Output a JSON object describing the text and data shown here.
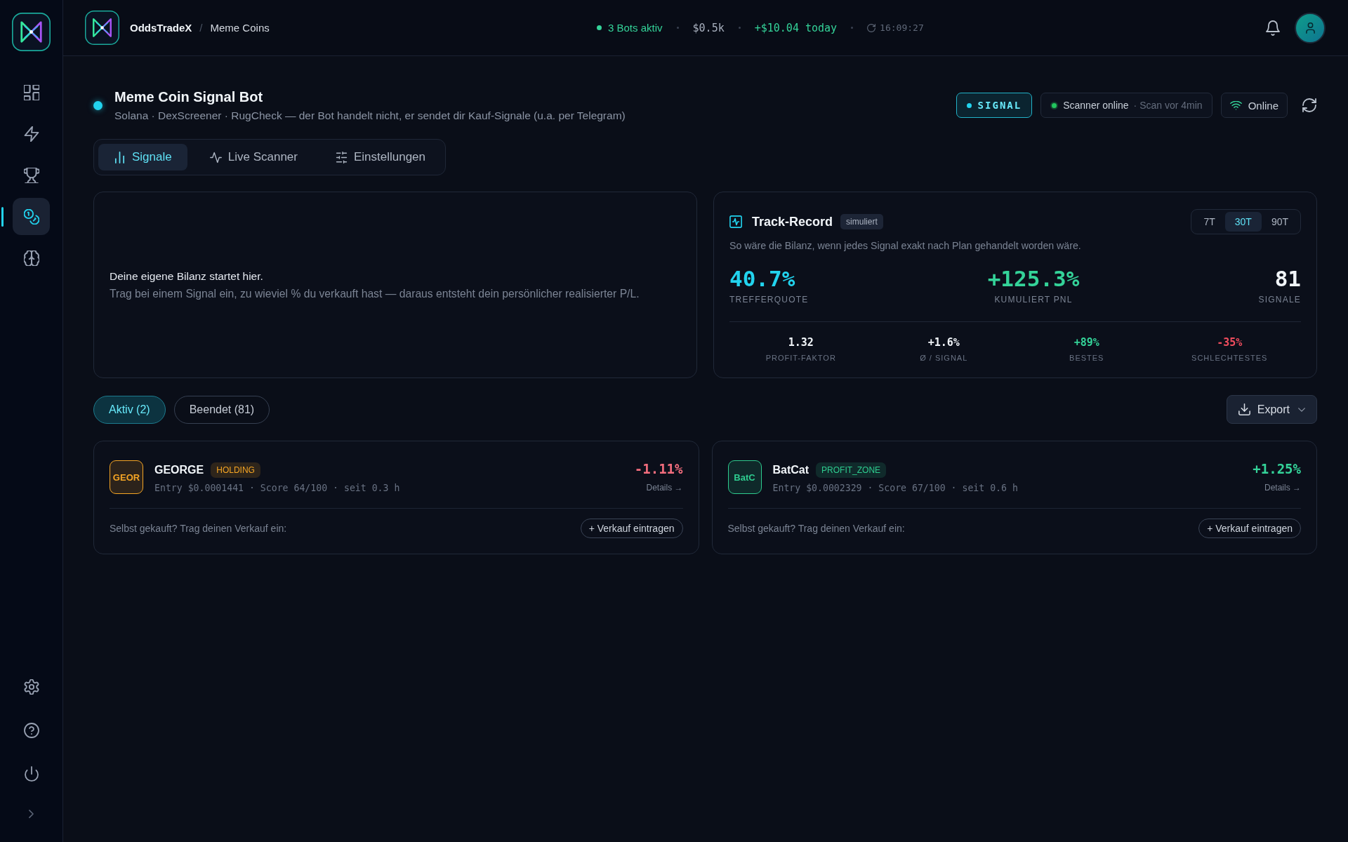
{
  "sidebar": {
    "items": [
      {
        "kind": "dashboard",
        "selected": false
      },
      {
        "kind": "bolt",
        "selected": false
      },
      {
        "kind": "trophy",
        "selected": false
      },
      {
        "kind": "coins",
        "selected": true
      },
      {
        "kind": "brain",
        "selected": false
      }
    ]
  },
  "header": {
    "brand": "OddsTradeX",
    "separator": "/",
    "page": "Meme Coins",
    "bots": "3 Bots aktiv",
    "balance": "$0.5k",
    "today": "+$10.04 today",
    "updated": "16:09:27"
  },
  "bot": {
    "name": "Meme Coin Signal Bot",
    "running": true,
    "description": "Solana · DexScreener · RugCheck — der Bot handelt nicht, er sendet dir Kauf-Signale (u.a. per Telegram)",
    "mode": "SIGNAL",
    "scanner": {
      "label": "Scanner online",
      "detail": "· Scan vor 4min",
      "online": true
    },
    "connection": {
      "label": "Online",
      "online": true
    }
  },
  "tabs": [
    {
      "label": "Signale",
      "kind": "chart",
      "selected": true
    },
    {
      "label": "Live Scanner",
      "kind": "pulse",
      "selected": false
    },
    {
      "label": "Einstellungen",
      "kind": "sliders",
      "selected": false
    }
  ],
  "own_balance": {
    "title": "Deine eigene Bilanz startet hier.",
    "text": "Trag bei einem Signal ein, zu wieviel % du verkauft hast — daraus entsteht dein persönlicher realisierter P/L."
  },
  "track_record": {
    "title": "Track-Record",
    "badge": "simuliert",
    "periods": [
      {
        "label": "7T",
        "selected": false
      },
      {
        "label": "30T",
        "selected": true
      },
      {
        "label": "90T",
        "selected": false
      }
    ],
    "subtitle": "So wäre die Bilanz, wenn jedes Signal exakt nach Plan gehandelt worden wäre.",
    "stats": [
      {
        "value": "40.7%",
        "label": "TREFFERQUOTE",
        "color": "#22d3ee"
      },
      {
        "value": "+125.3%",
        "label": "KUMULIERT PNL",
        "color": "#34d399"
      },
      {
        "value": "81",
        "label": "SIGNALE",
        "color": "#f1f5f9"
      }
    ],
    "details": [
      {
        "value": "1.32",
        "label": "PROFIT-FAKTOR",
        "color": "#f1f5f9"
      },
      {
        "value": "+1.6%",
        "label": "Ø / SIGNAL",
        "color": "#f1f5f9"
      },
      {
        "value": "+89%",
        "label": "BESTES",
        "color": "#34d399"
      },
      {
        "value": "-35%",
        "label": "SCHLECHTESTES",
        "color": "#f04d5e"
      }
    ]
  },
  "filters": [
    {
      "label": "Aktiv (2)",
      "selected": true
    },
    {
      "label": "Beendet (81)",
      "selected": false
    }
  ],
  "export": {
    "label": "Export"
  },
  "signals": [
    {
      "symbol": "GEOR",
      "name": "GEORGE",
      "status": "HOLDING",
      "color": "#f5a524",
      "meta": "Entry $0.0001441 · Score 64/100 · seit 0.3 h",
      "change": {
        "value": "-1.11%",
        "color": "#f26d7d"
      },
      "details": "Details →",
      "prompt": "Selbst gekauft? Trag deinen Verkauf ein:",
      "action": "+ Verkauf eintragen"
    },
    {
      "symbol": "BatC",
      "name": "BatCat",
      "status": "PROFIT_ZONE",
      "color": "#2ecc8f",
      "meta": "Entry $0.0002329 · Score 67/100 · seit 0.6 h",
      "change": {
        "value": "+1.25%",
        "color": "#34d399"
      },
      "details": "Details →",
      "prompt": "Selbst gekauft? Trag deinen Verkauf ein:",
      "action": "+ Verkauf eintragen"
    }
  ]
}
